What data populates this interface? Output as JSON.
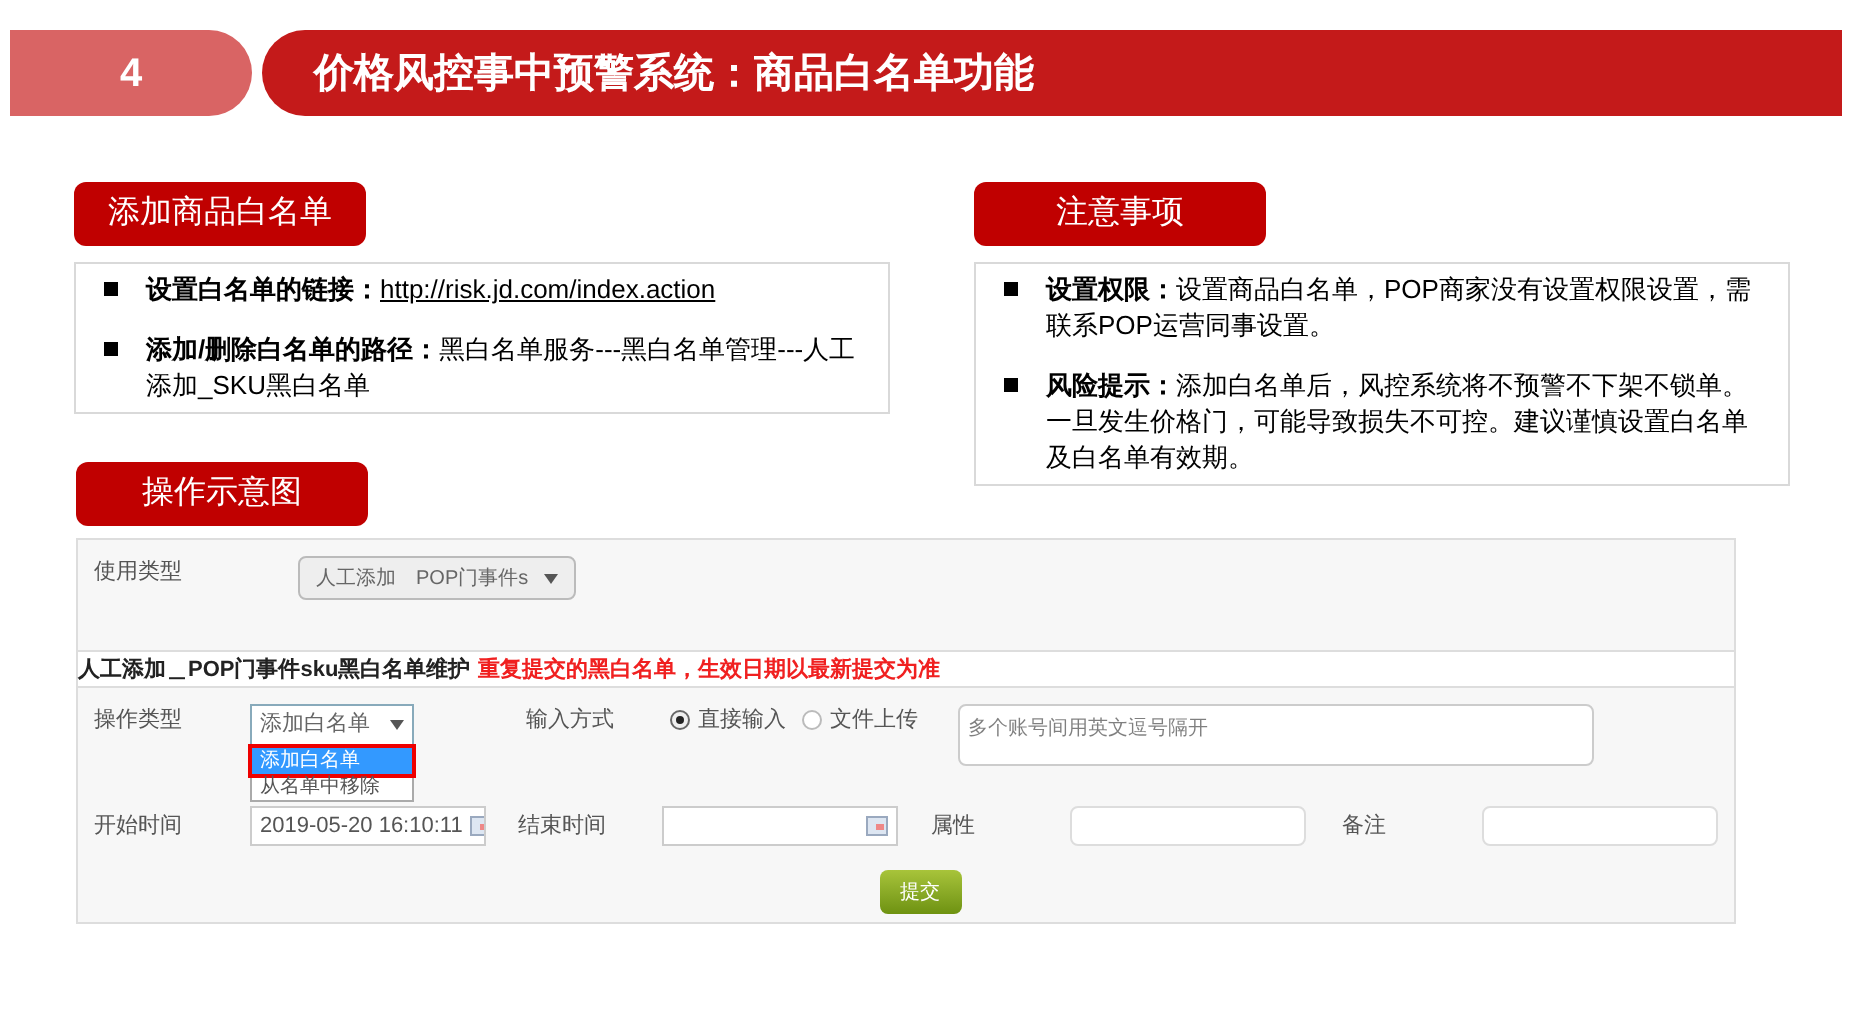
{
  "header": {
    "number": "4",
    "title": "价格风控事中预警系统：商品白名单功能"
  },
  "sections": [
    {
      "heading": "添加商品白名单",
      "items": [
        {
          "kind": "link",
          "label": "设置白名单的链接：",
          "text": "http://risk.jd.com/index.action"
        },
        {
          "kind": "text",
          "label": "添加/删除白名单的路径：",
          "text": "黑白名单服务---黑白名单管理---人工添加_SKU黑白名单"
        }
      ]
    },
    {
      "heading": "注意事项",
      "items": [
        {
          "kind": "text",
          "label": "设置权限：",
          "text": "设置商品白名单，POP商家没有设置权限设置，需联系POP运营同事设置。"
        },
        {
          "kind": "text",
          "label": "风险提示：",
          "text": "添加白名单后，风控系统将不预警不下架不锁单。一旦发生价格门，可能导致损失不可控。建议谨慎设置白名单及白名单有效期。"
        }
      ]
    }
  ],
  "demo": {
    "heading": "操作示意图",
    "usage_type": {
      "label": "使用类型",
      "value": "人工添加　POP门事件s"
    },
    "title": "人工添加＿POP门事件sku黑白名单维护",
    "warning": "重复提交的黑白名单，生效日期以最新提交为准",
    "operation": {
      "label": "操作类型",
      "value": "添加白名单",
      "expanded": true,
      "options": [
        {
          "label": "添加白名单",
          "selected": true
        },
        {
          "label": "从名单中移除",
          "selected": false
        }
      ]
    },
    "input_mode": {
      "label": "输入方式",
      "options": [
        {
          "label": "直接输入",
          "selected": true
        },
        {
          "label": "文件上传",
          "selected": false
        }
      ]
    },
    "accounts": {
      "placeholder": "多个账号间用英文逗号隔开"
    },
    "start_time": {
      "label": "开始时间",
      "value": "2019-05-20 16:10:11"
    },
    "end_time": {
      "label": "结束时间"
    },
    "attribute": {
      "label": "属性"
    },
    "note": {
      "label": "备注"
    },
    "submit": "提交"
  }
}
